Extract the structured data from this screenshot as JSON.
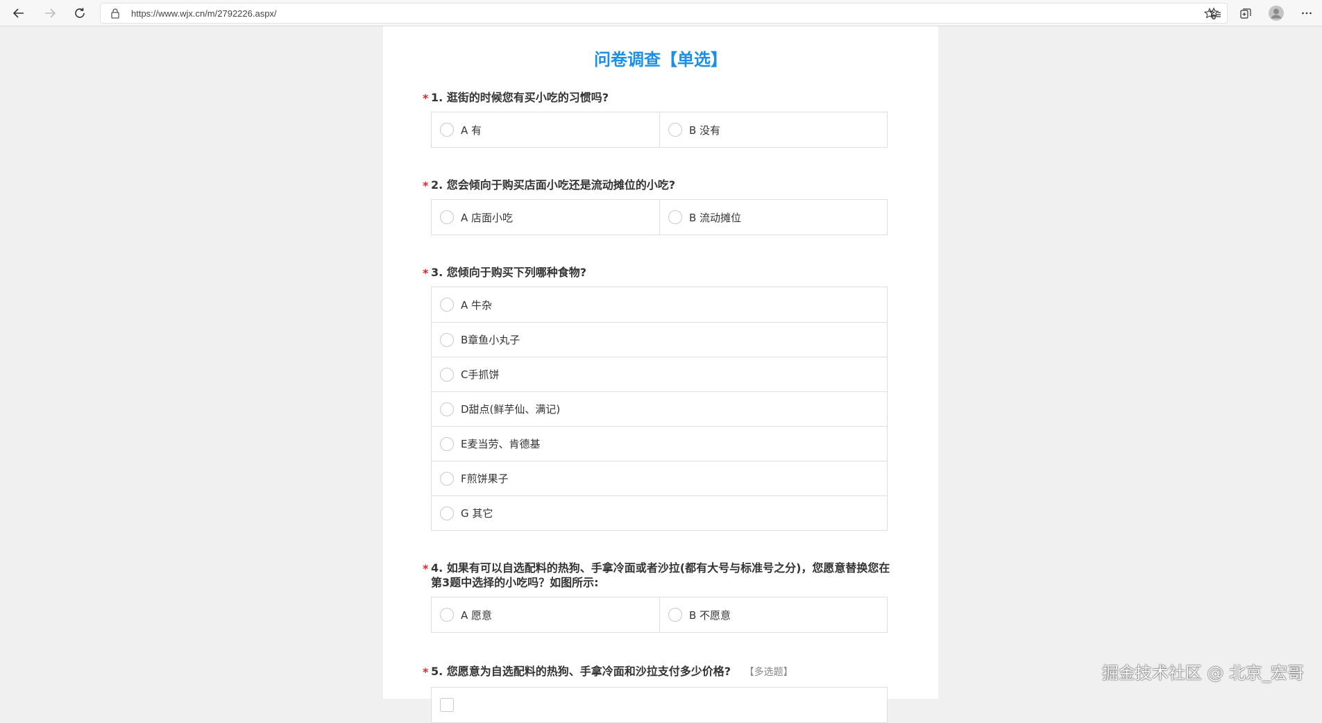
{
  "browser": {
    "url": "https://www.wjx.cn/m/2792226.aspx/",
    "icons": {
      "back": "arrow-left-icon",
      "forward": "arrow-right-icon",
      "refresh": "refresh-icon",
      "lock": "lock-icon",
      "favorite": "star-add-icon",
      "favorites": "favorites-icon",
      "collections": "collections-icon",
      "profile": "avatar-icon",
      "menu": "more-icon"
    }
  },
  "survey": {
    "title": "问卷调查【单选】",
    "required_mark": "*",
    "questions": [
      {
        "text": "1. 逛街的时候您有买小吃的习惯吗?",
        "options": [
          "A 有",
          "B 没有"
        ]
      },
      {
        "text": "2. 您会倾向于购买店面小吃还是流动摊位的小吃?",
        "options": [
          "A 店面小吃",
          "B 流动摊位"
        ]
      },
      {
        "text": "3. 您倾向于购买下列哪种食物?",
        "options": [
          "A 牛杂",
          "B章鱼小丸子",
          "C手抓饼",
          "D甜点(鲜芋仙、满记)",
          "E麦当劳、肯德基",
          "F煎饼果子",
          "G 其它"
        ]
      },
      {
        "text": "4. 如果有可以自选配料的热狗、手拿冷面或者沙拉(都有大号与标准号之分)，您愿意替换您在第3题中选择的小吃吗？如图所示:",
        "options": [
          "A 愿意",
          "B 不愿意"
        ]
      },
      {
        "text": "5. 您愿意为自选配料的热狗、手拿冷面和沙拉支付多少价格?",
        "tag": "【多选题】"
      }
    ]
  },
  "watermark": "掘金技术社区 @ 北京_宏哥",
  "colors": {
    "title": "#1b8fe5",
    "required": "#e52424",
    "background": "#f0f0f0"
  }
}
